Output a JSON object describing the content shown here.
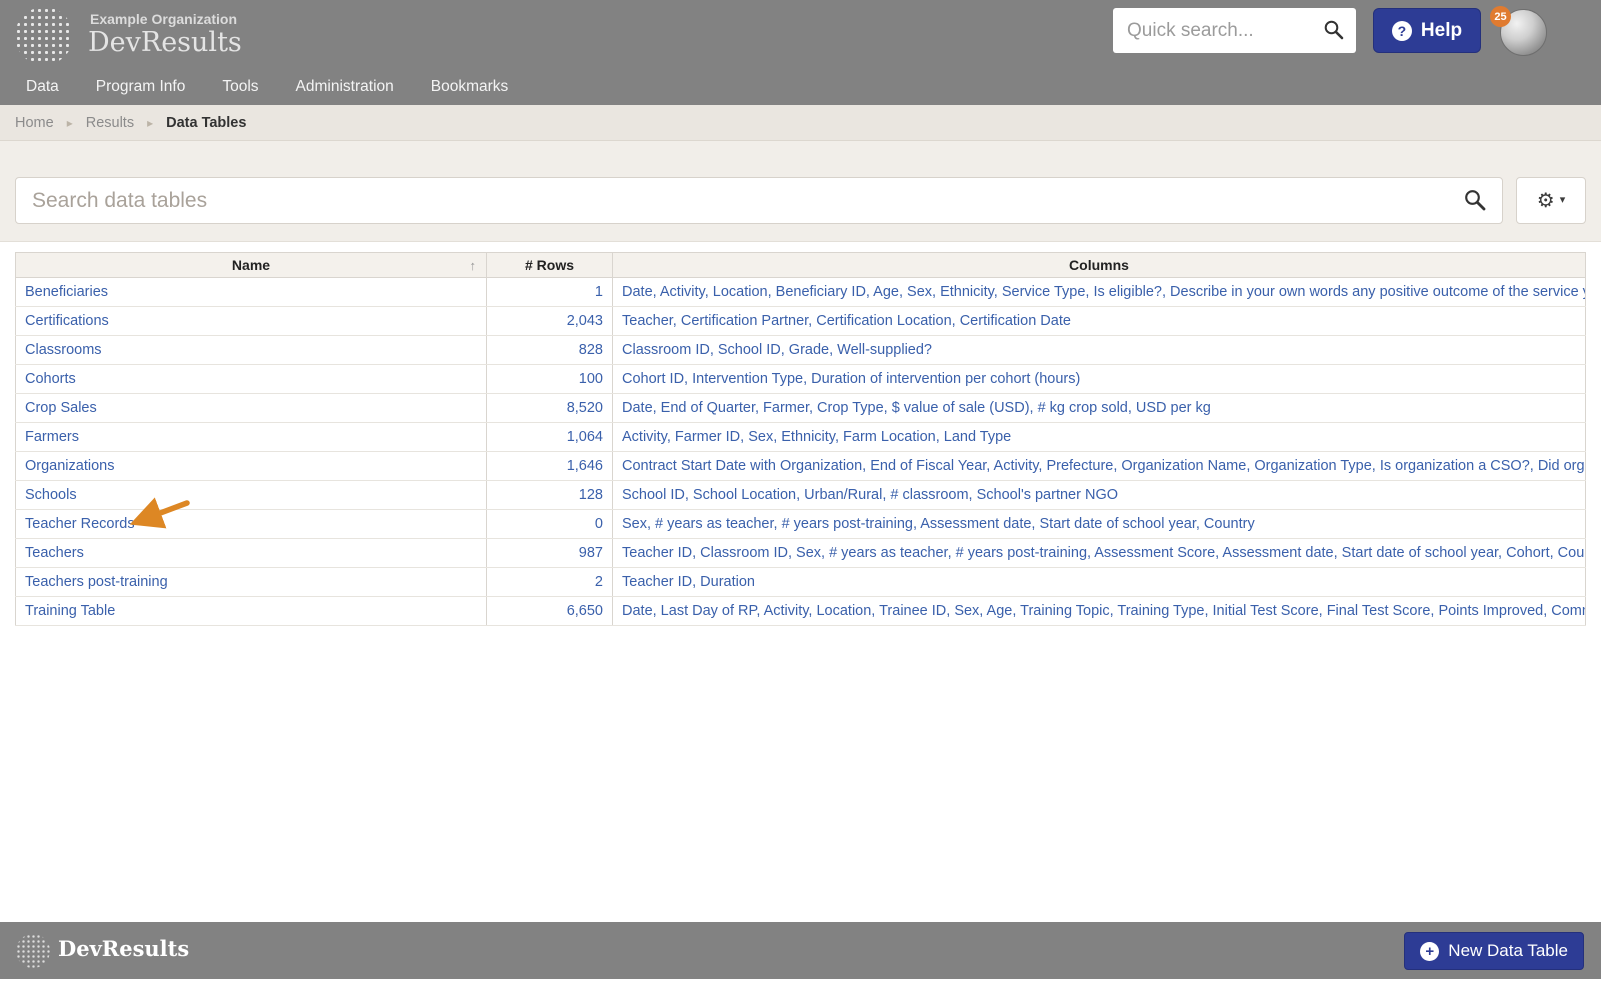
{
  "icons": {
    "breadcrumb_separator": "▸",
    "sort_ascending": "↑",
    "gear": "⚙",
    "caret_down": "▾",
    "help": "?",
    "plus": "+"
  },
  "header": {
    "org_name": "Example Organization",
    "brand": "DevResults",
    "quick_search_placeholder": "Quick search...",
    "help_label": "Help",
    "notification_count": "25"
  },
  "nav": {
    "items": [
      "Data",
      "Program Info",
      "Tools",
      "Administration",
      "Bookmarks"
    ]
  },
  "breadcrumb": {
    "items": [
      "Home",
      "Results",
      "Data Tables"
    ]
  },
  "search": {
    "placeholder": "Search data tables"
  },
  "table": {
    "headers": {
      "name": "Name",
      "row_count": "# Rows",
      "columns": "Columns"
    },
    "rows": [
      {
        "name": "Beneficiaries",
        "row_count": "1",
        "columns": "Date, Activity, Location, Beneficiary ID, Age, Sex, Ethnicity, Service Type, Is eligible?, Describe in your own words any positive outcome of the service you"
      },
      {
        "name": "Certifications",
        "row_count": "2,043",
        "columns": "Teacher, Certification Partner, Certification Location, Certification Date"
      },
      {
        "name": "Classrooms",
        "row_count": "828",
        "columns": "Classroom ID, School ID, Grade, Well-supplied?"
      },
      {
        "name": "Cohorts",
        "row_count": "100",
        "columns": "Cohort ID, Intervention Type, Duration of intervention per cohort (hours)"
      },
      {
        "name": "Crop Sales",
        "row_count": "8,520",
        "columns": "Date, End of Quarter, Farmer, Crop Type, $ value of sale (USD), # kg crop sold, USD per kg"
      },
      {
        "name": "Farmers",
        "row_count": "1,064",
        "columns": "Activity, Farmer ID, Sex, Ethnicity, Farm Location, Land Type"
      },
      {
        "name": "Organizations",
        "row_count": "1,646",
        "columns": "Contract Start Date with Organization, End of Fiscal Year, Activity, Prefecture, Organization Name, Organization Type, Is organization a CSO?, Did organization"
      },
      {
        "name": "Schools",
        "row_count": "128",
        "columns": "School ID, School Location, Urban/Rural, # classroom, School's partner NGO"
      },
      {
        "name": "Teacher Records",
        "row_count": "0",
        "columns": "Sex, # years as teacher, # years post-training, Assessment date, Start date of school year, Country"
      },
      {
        "name": "Teachers",
        "row_count": "987",
        "columns": "Teacher ID, Classroom ID, Sex, # years as teacher, # years post-training, Assessment Score, Assessment date, Start date of school year, Cohort, Country"
      },
      {
        "name": "Teachers post-training",
        "row_count": "2",
        "columns": "Teacher ID, Duration"
      },
      {
        "name": "Training Table",
        "row_count": "6,650",
        "columns": "Date, Last Day of RP, Activity, Location, Trainee ID, Sex, Age, Training Topic, Training Type, Initial Test Score, Final Test Score, Points Improved, Comments"
      }
    ]
  },
  "footer": {
    "brand": "DevResults",
    "new_data_table_label": "New Data Table"
  },
  "colors": {
    "accent_blue": "#2d3c95",
    "link_blue": "#3a60ab",
    "header_gray": "#828282",
    "badge_orange": "#e07b30",
    "arrow_orange": "#dd8724"
  }
}
